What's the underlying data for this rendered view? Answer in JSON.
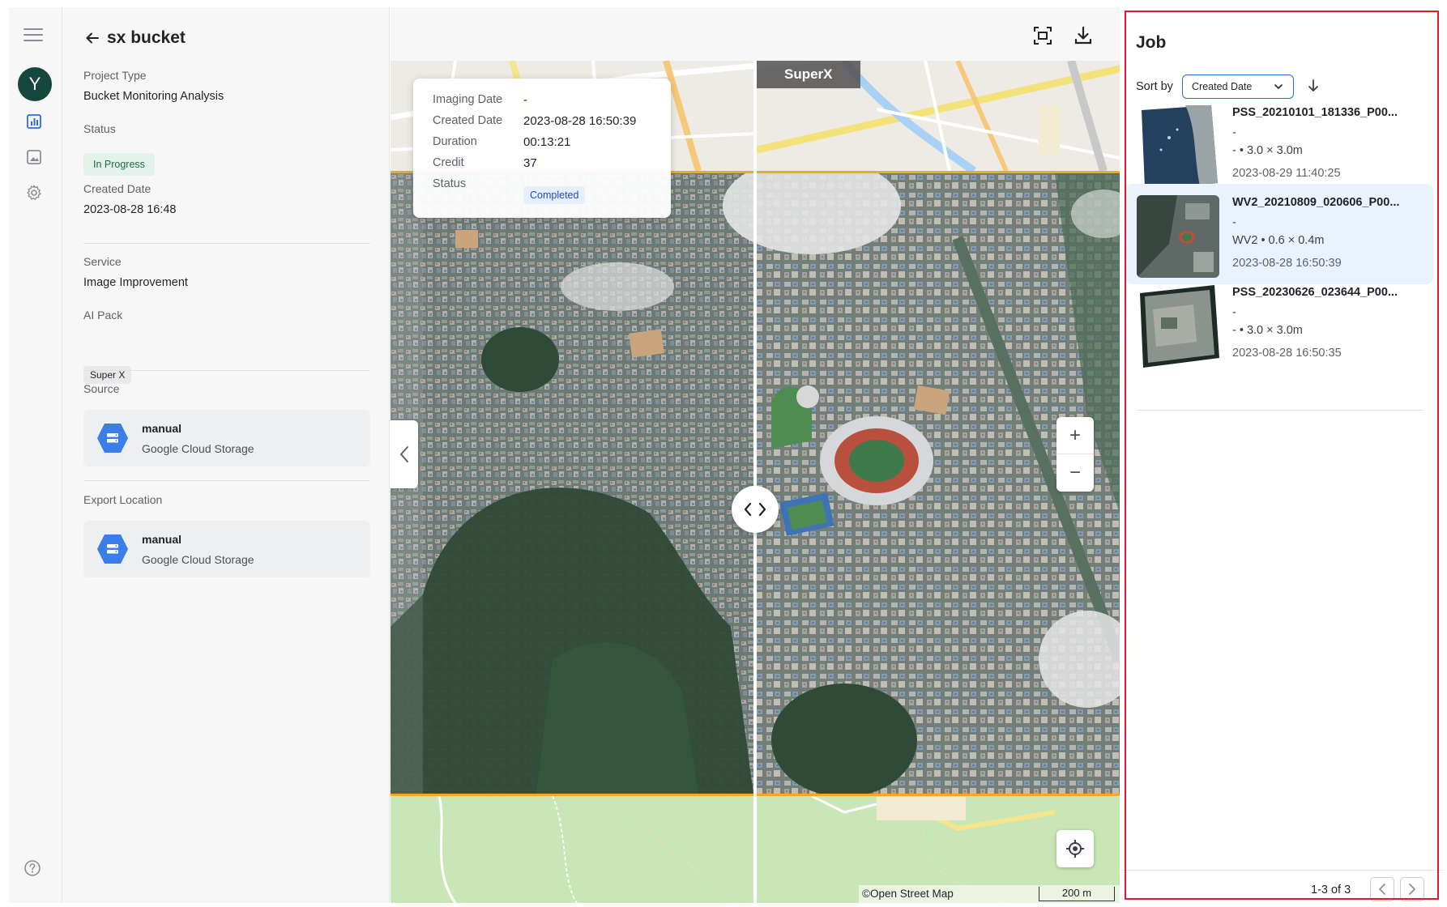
{
  "rail": {
    "avatar_letter": "Y"
  },
  "project": {
    "title": "sx bucket",
    "project_type_label": "Project Type",
    "project_type": "Bucket Monitoring Analysis",
    "status_label": "Status",
    "status": "In Progress",
    "created_label": "Created Date",
    "created": "2023-08-28 16:48",
    "service_label": "Service",
    "service": "Image Improvement",
    "aipack_label": "AI Pack",
    "aipack": "Super X",
    "source_label": "Source",
    "source": {
      "name": "manual",
      "type": "Google Cloud Storage"
    },
    "export_label": "Export Location",
    "export": {
      "name": "manual",
      "type": "Google Cloud Storage"
    }
  },
  "map": {
    "compare_label": "SuperX",
    "info": {
      "imaging_date_label": "Imaging Date",
      "imaging_date": "-",
      "created_label": "Created Date",
      "created": "2023-08-28 16:50:39",
      "duration_label": "Duration",
      "duration": "00:13:21",
      "credit_label": "Credit",
      "credit": "37",
      "status_label": "Status",
      "status": "Completed"
    },
    "zoom_in": "+",
    "zoom_out": "−",
    "attribution": "©Open Street Map",
    "scale": "200 m",
    "frame_color": "#f5a623"
  },
  "jobs": {
    "title": "Job",
    "sort_label": "Sort by",
    "sort_value": "Created Date",
    "items": [
      {
        "name": "PSS_20210101_181336_P00...",
        "line1": "-",
        "line2": "- • 3.0 × 3.0m",
        "date": "2023-08-29 11:40:25"
      },
      {
        "name": "WV2_20210809_020606_P00...",
        "line1": "-",
        "line2": "WV2 • 0.6 × 0.4m",
        "date": "2023-08-28 16:50:39"
      },
      {
        "name": "PSS_20230626_023644_P00...",
        "line1": "-",
        "line2": "- • 3.0 × 3.0m",
        "date": "2023-08-28 16:50:35"
      }
    ],
    "pagination": "1-3 of 3"
  },
  "colors": {
    "accent": "#2d6be4",
    "highlight_frame": "#e0192c",
    "avatar": "#16473d"
  }
}
